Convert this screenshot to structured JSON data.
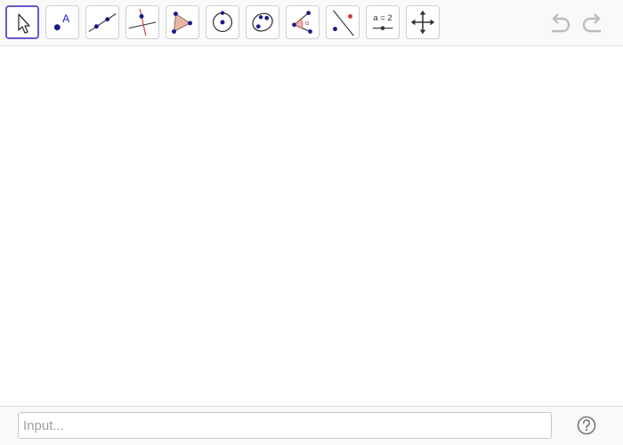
{
  "toolbar": {
    "tools": [
      {
        "name": "move-tool",
        "icon": "arrow-cursor-icon",
        "active": true
      },
      {
        "name": "point-tool",
        "icon": "point-icon",
        "label": "A"
      },
      {
        "name": "line-tool",
        "icon": "line-through-points-icon"
      },
      {
        "name": "perpendicular-line-tool",
        "icon": "perpendicular-line-icon"
      },
      {
        "name": "polygon-tool",
        "icon": "polygon-icon"
      },
      {
        "name": "circle-center-point-tool",
        "icon": "circle-center-icon"
      },
      {
        "name": "ellipse-tool",
        "icon": "ellipse-icon"
      },
      {
        "name": "angle-tool",
        "icon": "angle-icon",
        "label": "α"
      },
      {
        "name": "reflect-tool",
        "icon": "reflect-icon"
      },
      {
        "name": "slider-tool",
        "icon": "slider-icon",
        "label": "a = 2"
      },
      {
        "name": "move-graphics-view-tool",
        "icon": "move-arrows-icon"
      }
    ],
    "undo_icon": "undo-icon",
    "redo_icon": "redo-icon"
  },
  "input_bar": {
    "placeholder": "Input...",
    "value": "",
    "help_icon": "help-icon"
  },
  "colors": {
    "active_border": "#6557d2",
    "point_blue": "#1a1a8c",
    "label_blue": "#2020c0",
    "accent_red": "#d23c3c",
    "polygon_fill": "#e8b6a6"
  }
}
